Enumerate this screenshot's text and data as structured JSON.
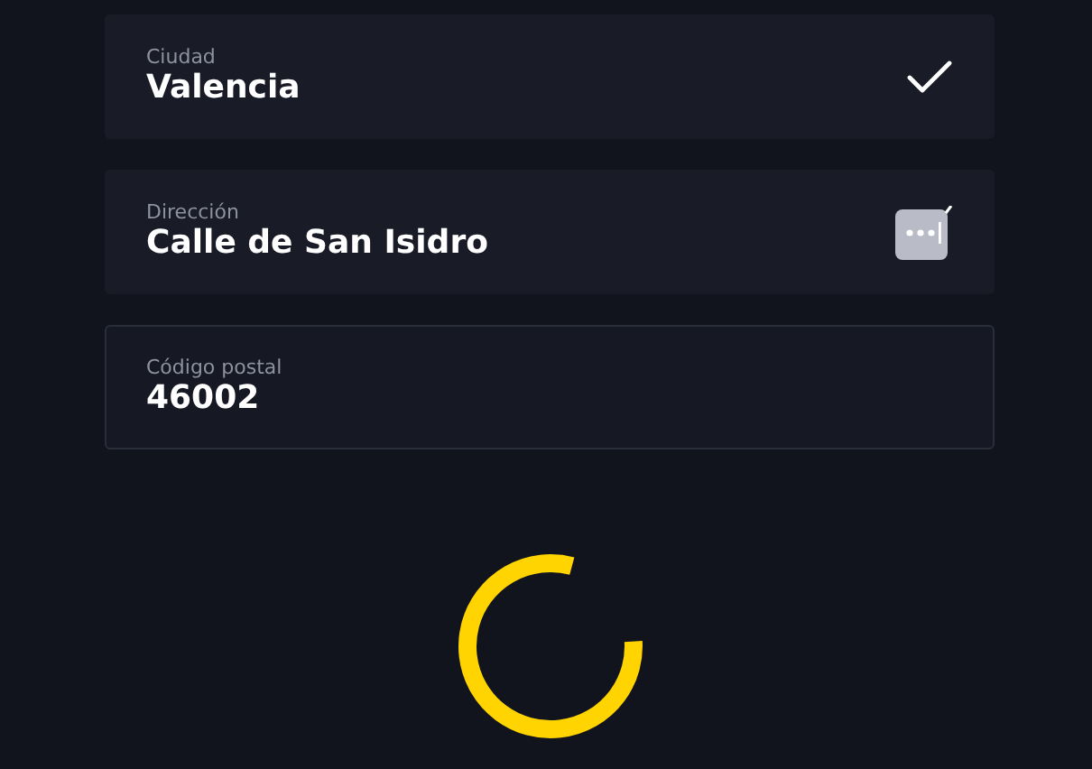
{
  "fields": [
    {
      "label": "Ciudad",
      "value": "Valencia",
      "kind": "valid",
      "focused": false
    },
    {
      "label": "Dirección",
      "value": "Calle de San Isidro",
      "kind": "autofill",
      "focused": false
    },
    {
      "label": "Código postal",
      "value": "46002",
      "kind": "plain",
      "focused": true
    }
  ],
  "spinner": {
    "kind": "loading"
  }
}
